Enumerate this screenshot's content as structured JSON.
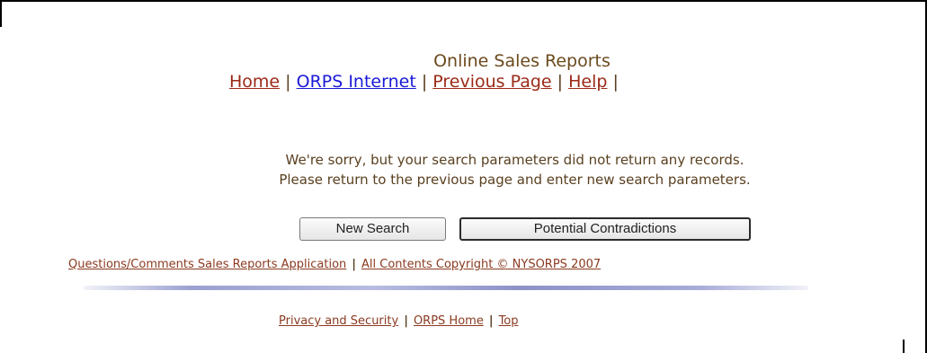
{
  "header": {
    "title": "Online Sales Reports",
    "nav": [
      {
        "label": "Home"
      },
      {
        "label": "ORPS Internet"
      },
      {
        "label": "Previous Page"
      },
      {
        "label": "Help"
      }
    ],
    "separator": "|"
  },
  "message": {
    "line1": "We're sorry, but your search parameters did not return any records.",
    "line2": "Please return to the previous page and enter new search parameters."
  },
  "buttons": {
    "new_search": "New Search",
    "potential_contradictions": "Potential Contradictions"
  },
  "footer": {
    "questions_link": "Questions/Comments Sales Reports Application",
    "copyright_link": "All Contents Copyright © NYSORPS 2007",
    "privacy_link": "Privacy and Security",
    "orps_home_link": "ORPS Home",
    "top_link": "Top"
  },
  "colors": {
    "link_visited": "#9b2a17",
    "link_blue": "#1a1ad8",
    "text": "#5a4020"
  }
}
